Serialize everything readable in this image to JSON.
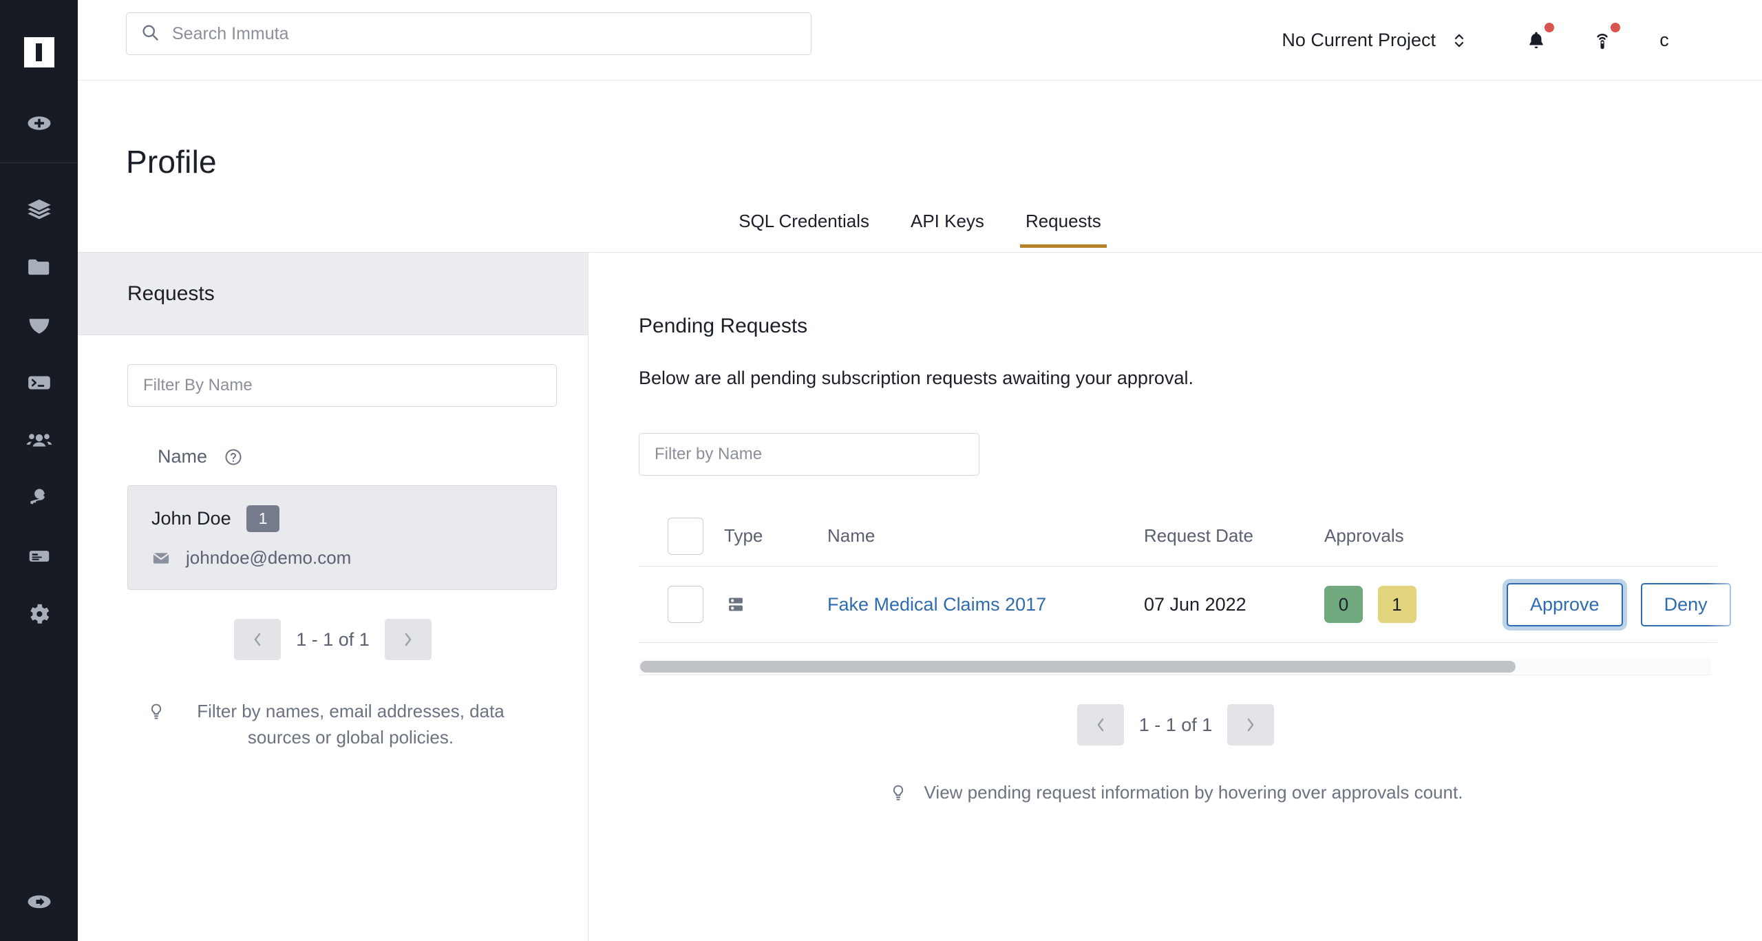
{
  "app": {
    "logo_icon": "immuta-logo-icon"
  },
  "sidebar": {
    "items": [
      {
        "icon": "plus-circle-icon",
        "name": "add"
      },
      {
        "icon": "layers-icon",
        "name": "data-sources"
      },
      {
        "icon": "folder-icon",
        "name": "projects"
      },
      {
        "icon": "shield-icon",
        "name": "policies"
      },
      {
        "icon": "terminal-icon",
        "name": "queries"
      },
      {
        "icon": "users-icon",
        "name": "people"
      },
      {
        "icon": "key-icon",
        "name": "governance"
      },
      {
        "icon": "report-icon",
        "name": "audit"
      },
      {
        "icon": "gear-icon",
        "name": "settings"
      },
      {
        "icon": "logout-circle-icon",
        "name": "logout"
      }
    ]
  },
  "topbar": {
    "search_placeholder": "Search Immuta",
    "search_value": "",
    "search_icon": "search-icon",
    "project_label": "No Current Project",
    "project_chevron_icon": "chevron-up-down-icon",
    "notifications_icon": "bell-icon",
    "broadcast_icon": "broadcast-icon",
    "avatar_label": "c",
    "notification_dot_color": "#d9534f"
  },
  "page": {
    "title": "Profile",
    "accent_color": "#b5832c"
  },
  "tabs": [
    {
      "label": "SQL Credentials",
      "active": false
    },
    {
      "label": "API Keys",
      "active": false
    },
    {
      "label": "Requests",
      "active": true
    }
  ],
  "left_panel": {
    "header_title": "Requests",
    "filter_placeholder": "Filter By Name",
    "filter_value": "",
    "column_label": "Name",
    "help_icon": "question-circle-icon",
    "person": {
      "name": "John Doe",
      "count_badge": "1",
      "email": "johndoe@demo.com",
      "mail_icon": "mail-icon"
    },
    "pager": {
      "prev_icon": "chevron-left-icon",
      "next_icon": "chevron-right-icon",
      "range_text": "1 - 1 of 1"
    },
    "hint": {
      "icon": "lightbulb-icon",
      "text": "Filter by names, email addresses, data sources or global policies."
    }
  },
  "main": {
    "title": "Pending Requests",
    "subtitle": "Below are all pending subscription requests awaiting your approval.",
    "filter_placeholder": "Filter by Name",
    "filter_value": "",
    "table": {
      "columns": [
        "",
        "Type",
        "Name",
        "Request Date",
        "Approvals"
      ],
      "rows": [
        {
          "checked": false,
          "type_icon": "server-icon",
          "name": "Fake Medical Claims 2017",
          "request_date": "07 Jun 2022",
          "approvals_current": "0",
          "approvals_required": "1",
          "approvals_current_color": "#71a97f",
          "approvals_required_color": "#e2d47c",
          "approve_label": "Approve",
          "approve_focused": true,
          "secondary_label": "Deny"
        }
      ]
    },
    "scrollbar": {
      "orientation": "horizontal",
      "thumb_percent": 82
    },
    "pager": {
      "prev_icon": "chevron-left-icon",
      "next_icon": "chevron-right-icon",
      "range_text": "1 - 1 of 1"
    },
    "hint": {
      "icon": "lightbulb-icon",
      "text": "View pending request information by hovering over approvals count."
    }
  }
}
